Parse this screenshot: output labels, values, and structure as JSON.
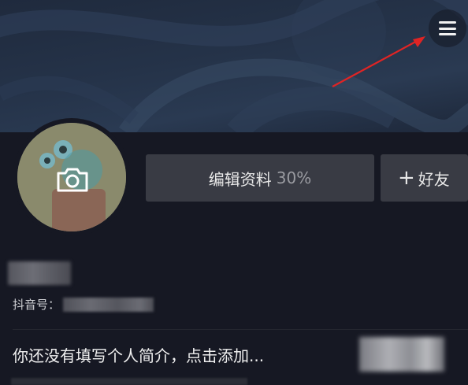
{
  "header": {
    "menu_icon": "hamburger-menu-icon"
  },
  "profile": {
    "avatar_icon": "camera-icon",
    "edit_profile_label": "编辑资料",
    "edit_profile_progress": "30%",
    "add_friend_plus": "+",
    "add_friend_label": "好友",
    "douyin_id_label": "抖音号：",
    "bio_placeholder": "你还没有填写个人简介，点击添加..."
  },
  "colors": {
    "background": "#161823",
    "button_bg": "#393b44",
    "arrow": "#e02424",
    "text_primary": "#f0f0f0",
    "text_muted": "#9a9ba1"
  }
}
